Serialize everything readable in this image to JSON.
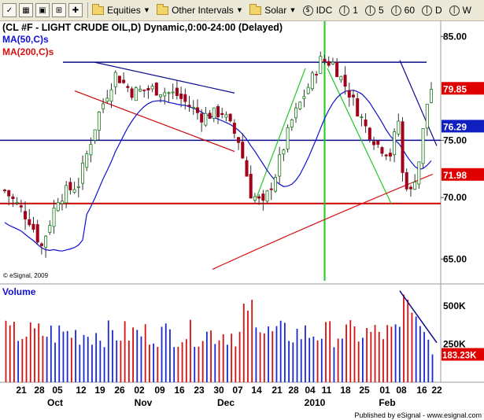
{
  "toolbar": {
    "equities_label": "Equities",
    "intervals_label": "Other Intervals",
    "solar_label": "Solar",
    "idc_label": "IDC",
    "n1_label": "1",
    "n5_label": "5",
    "n60_label": "60",
    "d_label": "D",
    "ws_label": "W"
  },
  "chart_data": {
    "type": "candlestick",
    "title": "(CL #F - LIGHT CRUDE OIL,D) Dynamic,0:00-24:00 (Delayed)",
    "indicators": [
      {
        "name": "MA(50,C)s",
        "color": "#1010d0"
      },
      {
        "name": "MA(200,C)s",
        "color": "#d81010"
      }
    ],
    "price_axis": {
      "scale": "log",
      "range": [
        63.5,
        86
      ],
      "ticks": [
        85.0,
        75.0,
        70.0,
        65.0
      ]
    },
    "price_tags": [
      {
        "label": "79.85",
        "color": "#e00000"
      },
      {
        "label": "76.29",
        "color": "#1020c0"
      },
      {
        "label": "71.98",
        "color": "#e00000"
      }
    ],
    "copyright": "© eSignal, 2009",
    "volume": {
      "label": "Volume",
      "range": [
        0,
        620000
      ],
      "ticks": [
        {
          "value": 500000,
          "label": "500K"
        },
        {
          "value": 250000,
          "label": "250K"
        }
      ],
      "last_tag": {
        "label": "183.23K",
        "color": "#e00000"
      }
    },
    "x_ticks": [
      "21",
      "28",
      "05",
      "12",
      "19",
      "26",
      "02",
      "09",
      "16",
      "23",
      "30",
      "07",
      "14",
      "21",
      "28",
      "04",
      "11",
      "18",
      "25",
      "01",
      "08",
      "16",
      "22"
    ],
    "month_labels": [
      "Oct",
      "Nov",
      "Dec",
      "2010",
      "Feb"
    ],
    "footer": "Published by eSignal - www.esignal.com",
    "levels": [
      {
        "price": 82.4,
        "color": "#0a0a8c"
      },
      {
        "price": 75.0,
        "color": "#0a0a8c"
      },
      {
        "price": 69.5,
        "color": "#cc0000"
      }
    ]
  }
}
